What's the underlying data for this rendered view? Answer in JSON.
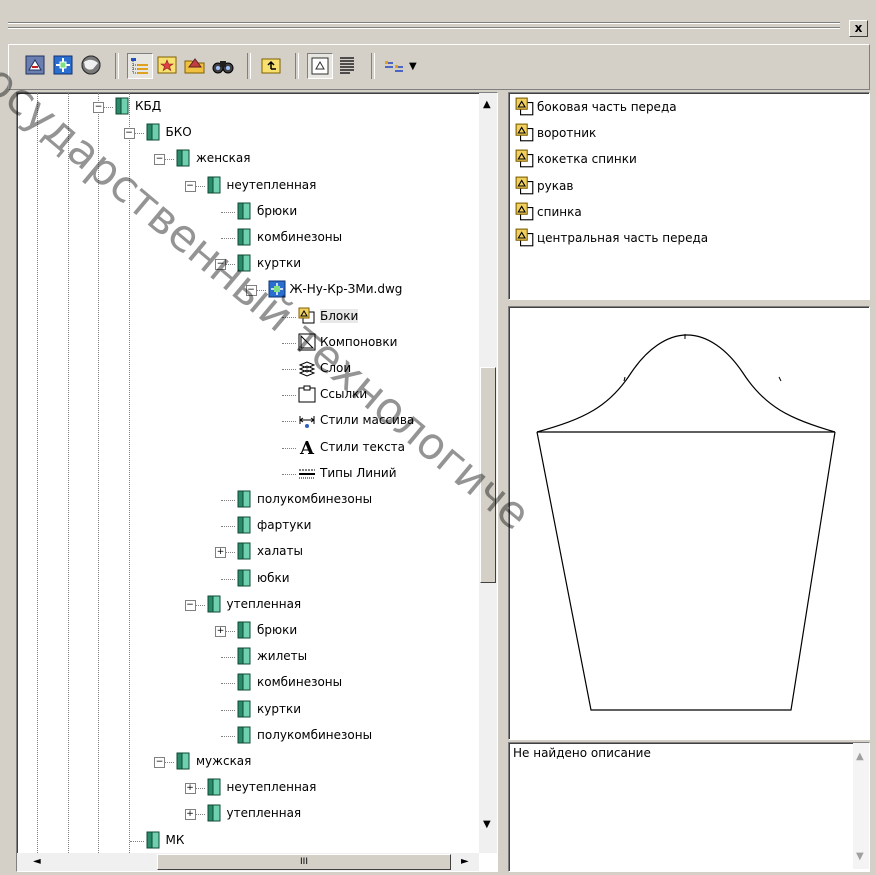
{
  "window": {
    "close_label": "x"
  },
  "toolbar": {
    "icons": [
      "home-icon",
      "tree-toggle-icon",
      "globe-icon",
      "treeview-icon",
      "favorites-icon",
      "load-icon",
      "search-icon",
      "up-icon",
      "preview-icon",
      "description-icon",
      "views-icon"
    ],
    "views_arrow": "▼"
  },
  "tree": {
    "nodes": [
      {
        "label": "КБД"
      },
      {
        "label": "БКО"
      },
      {
        "label": "женская"
      },
      {
        "label": "неутепленная"
      },
      {
        "label": "брюки"
      },
      {
        "label": "комбинезоны"
      },
      {
        "label": "куртки"
      },
      {
        "label": "Ж-Ну-Кр-ЗМи.dwg"
      },
      {
        "label": "Блоки"
      },
      {
        "label": "Компоновки"
      },
      {
        "label": "Слои"
      },
      {
        "label": "Ссылки"
      },
      {
        "label": "Стили массива"
      },
      {
        "label": "Стили текста"
      },
      {
        "label": "Типы Линий"
      },
      {
        "label": "полукомбинезоны"
      },
      {
        "label": "фартуки"
      },
      {
        "label": "халаты"
      },
      {
        "label": "юбки"
      },
      {
        "label": "утепленная"
      },
      {
        "label": "брюки"
      },
      {
        "label": "жилеты"
      },
      {
        "label": "комбинезоны"
      },
      {
        "label": "куртки"
      },
      {
        "label": "полукомбинезоны"
      },
      {
        "label": "мужская"
      },
      {
        "label": "неутепленная"
      },
      {
        "label": "утепленная"
      },
      {
        "label": "МК"
      }
    ],
    "hscroll_grip": "III"
  },
  "blocks_list": {
    "items": [
      "боковая часть переда",
      "воротник",
      "кокетка спинки",
      "рукав",
      "спинка",
      "центральная часть переда"
    ]
  },
  "description": {
    "text": "Не найдено описание"
  },
  "watermark": {
    "line1": "государственный технологиче"
  }
}
